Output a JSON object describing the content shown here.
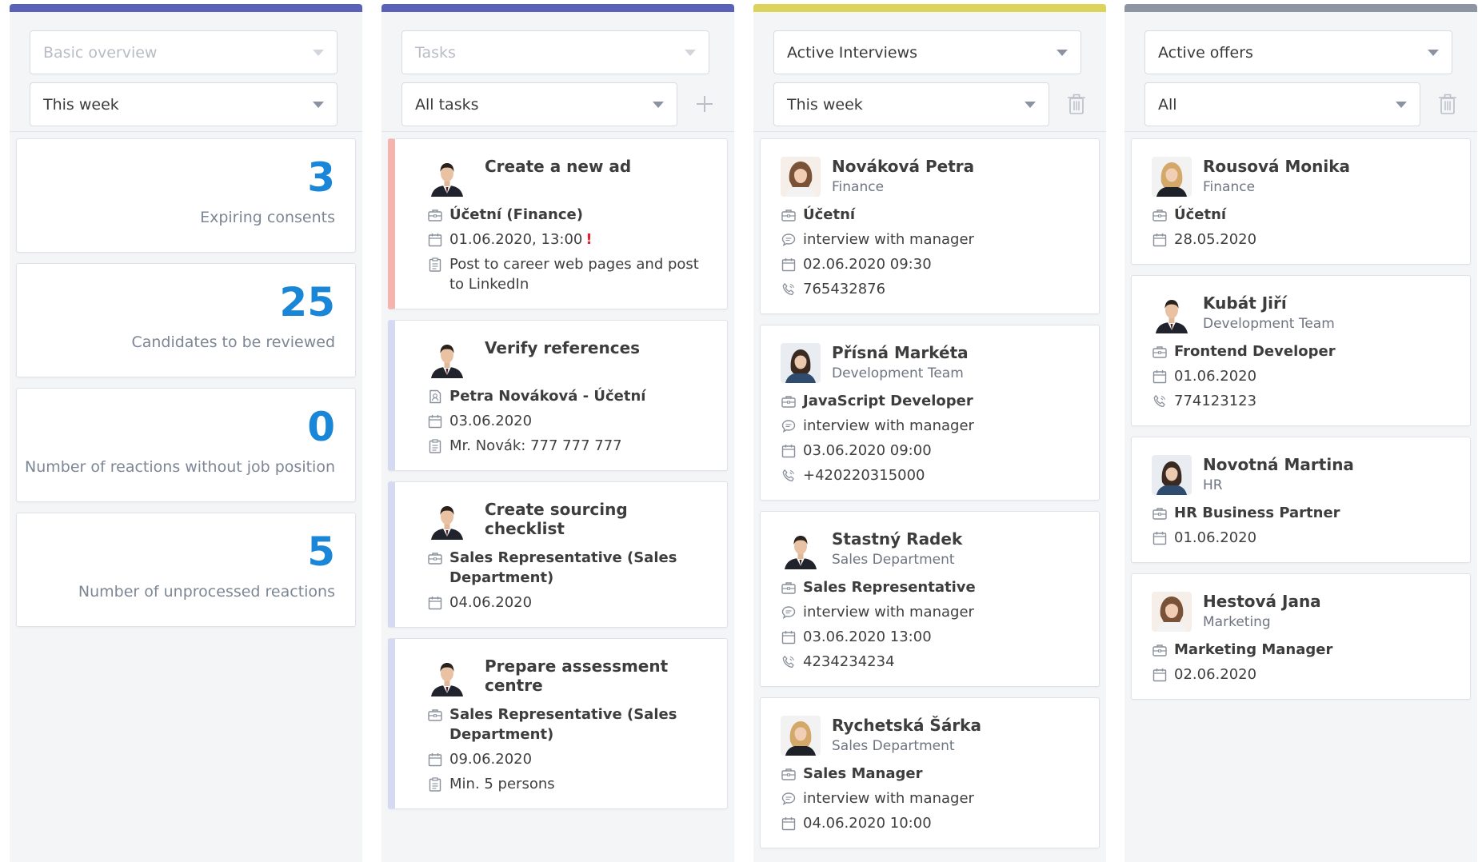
{
  "colors": {
    "accent_blue": "#1a86d8",
    "bar_overview": "#5a62b8",
    "bar_tasks": "#5a62b8",
    "bar_interviews": "#dcd35a",
    "bar_offers": "#8d95a3",
    "urgent_stripe": "#f5b4ad",
    "task_stripe": "#d6d9f2"
  },
  "overview": {
    "select1": "Basic overview",
    "select2": "This week",
    "cards": [
      {
        "value": "3",
        "label": "Expiring consents"
      },
      {
        "value": "25",
        "label": "Candidates to be reviewed"
      },
      {
        "value": "0",
        "label": "Number of reactions without job position"
      },
      {
        "value": "5",
        "label": "Number of unprocessed reactions"
      }
    ]
  },
  "tasks": {
    "select1": "Tasks",
    "select2": "All tasks",
    "add_icon": "plus-icon",
    "items": [
      {
        "title": "Create a new ad",
        "position": "Účetní (Finance)",
        "date": "01.06.2020, 13:00",
        "alert": "!",
        "note": "Post to career web pages and post to LinkedIn"
      },
      {
        "title": "Verify references",
        "candidate": "Petra Nováková - Účetní",
        "date": "03.06.2020",
        "note": "Mr. Novák: 777 777 777"
      },
      {
        "title": "Create sourcing checklist",
        "position": "Sales Representative (Sales Department)",
        "date": "04.06.2020"
      },
      {
        "title": "Prepare assessment centre",
        "position": "Sales Representative (Sales Department)",
        "date": "09.06.2020",
        "note": "Min. 5 persons"
      }
    ]
  },
  "interviews": {
    "select1": "Active Interviews",
    "select2": "This week",
    "delete_icon": "trash-icon",
    "items": [
      {
        "name": "Nováková Petra",
        "dept": "Finance",
        "position": "Účetní",
        "type": "interview with manager",
        "datetime": "02.06.2020 09:30",
        "phone": "765432876"
      },
      {
        "name": "Přísná Markéta",
        "dept": "Development Team",
        "position": "JavaScript Developer",
        "type": "interview with manager",
        "datetime": "03.06.2020 09:00",
        "phone": "+420220315000"
      },
      {
        "name": "Stastný Radek",
        "dept": "Sales Department",
        "position": "Sales Representative",
        "type": "interview with manager",
        "datetime": "03.06.2020 13:00",
        "phone": "4234234234"
      },
      {
        "name": "Rychetská Šárka",
        "dept": "Sales Department",
        "position": "Sales Manager",
        "type": "interview with manager",
        "datetime": "04.06.2020 10:00"
      }
    ]
  },
  "offers": {
    "select1": "Active offers",
    "select2": "All",
    "delete_icon": "trash-icon",
    "items": [
      {
        "name": "Rousová Monika",
        "dept": "Finance",
        "position": "Účetní",
        "date": "28.05.2020"
      },
      {
        "name": "Kubát Jiří",
        "dept": "Development Team",
        "position": "Frontend Developer",
        "date": "01.06.2020",
        "phone": "774123123"
      },
      {
        "name": "Novotná Martina",
        "dept": "HR",
        "position": "HR Business Partner",
        "date": "01.06.2020"
      },
      {
        "name": "Hestová Jana",
        "dept": "Marketing",
        "position": "Marketing Manager",
        "date": "02.06.2020"
      }
    ]
  }
}
